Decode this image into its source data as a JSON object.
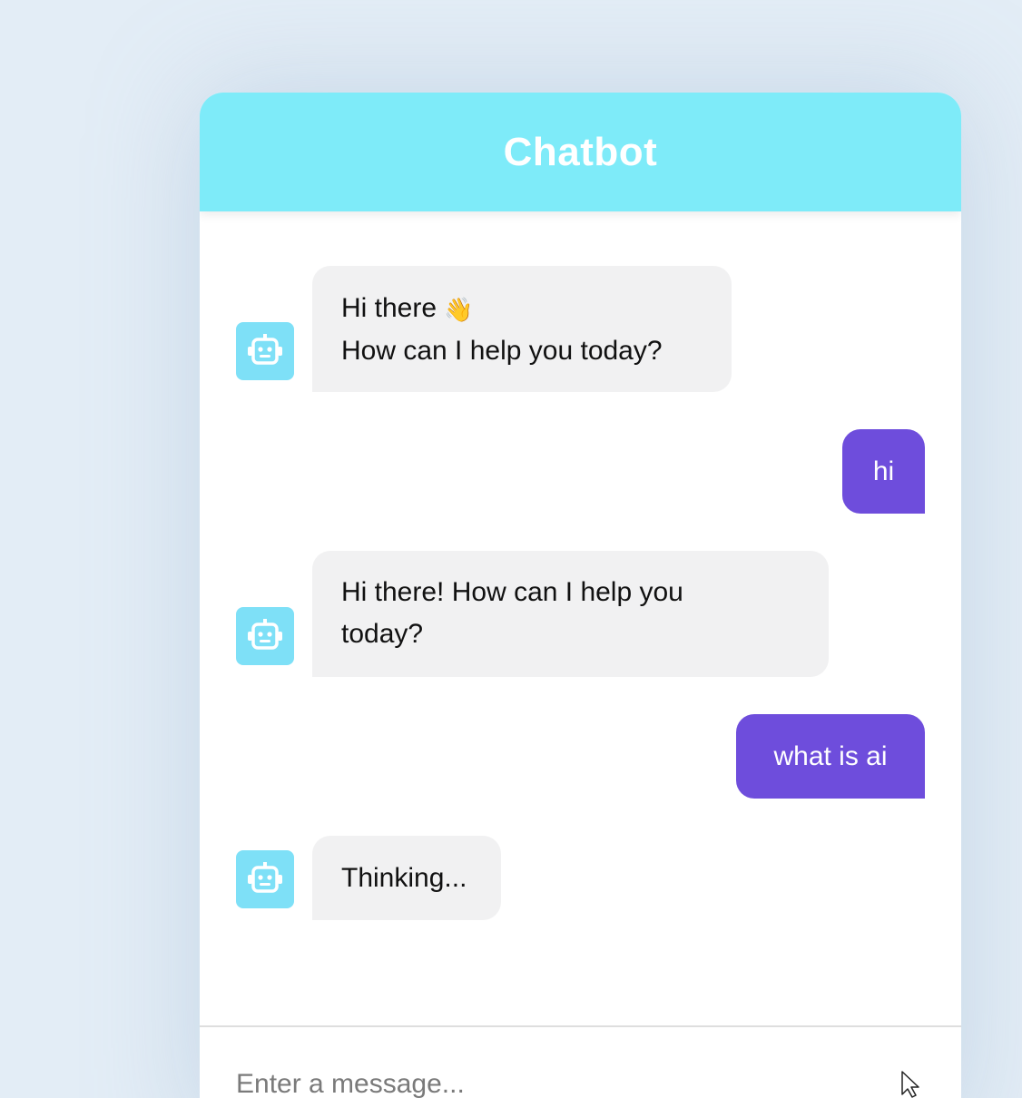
{
  "header": {
    "title": "Chatbot"
  },
  "messages": [
    {
      "type": "incoming",
      "lines": [
        "Hi there",
        "How can I help you today?"
      ],
      "emoji": "👋"
    },
    {
      "type": "outgoing",
      "text": "hi"
    },
    {
      "type": "incoming",
      "lines": [
        "Hi there! How can I help you",
        "today?"
      ]
    },
    {
      "type": "outgoing",
      "text": "what is ai"
    },
    {
      "type": "incoming",
      "lines": [
        "Thinking..."
      ]
    }
  ],
  "input": {
    "placeholder": "Enter a message..."
  },
  "icons": {
    "avatar": "robot-icon",
    "cursor": "mouse-pointer-icon"
  },
  "colors": {
    "header": "#7eebf9",
    "outgoing_bubble": "#6e4ddc",
    "incoming_bubble": "#f1f1f2",
    "avatar": "#7ee0f7",
    "background": "#e3edf6"
  }
}
